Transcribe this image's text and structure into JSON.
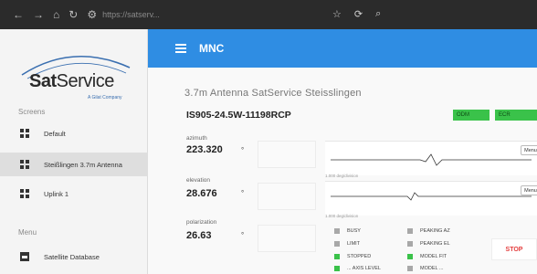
{
  "browser": {
    "url": "https://satserv..."
  },
  "sidebar": {
    "logo": {
      "brand_bold": "Sat",
      "brand_rest": "Service",
      "subline": "A Gilat Company"
    },
    "screens_label": "Screens",
    "screens": [
      {
        "label": "Default",
        "active": false
      },
      {
        "label": "Steißlingen 3.7m Antenna",
        "active": true
      },
      {
        "label": "Uplink 1",
        "active": false
      }
    ],
    "menu_label": "Menu",
    "menu": [
      {
        "label": "Satellite Database"
      }
    ]
  },
  "header": {
    "title": "MNC"
  },
  "main": {
    "page_title": "3.7m Antenna SatService Steisslingen",
    "satellite_id": "IS905-24.5W-11198RCP",
    "badges": [
      "ODM",
      "ECR"
    ],
    "fields": [
      {
        "label": "azimuth",
        "value": "223.320",
        "unit": "°"
      },
      {
        "label": "elevation",
        "value": "28.676",
        "unit": "°"
      },
      {
        "label": "polarization",
        "value": "26.63",
        "unit": "°"
      }
    ],
    "panels": [
      {
        "menu_label": "Menu",
        "caption": "1.000 deg/division"
      },
      {
        "menu_label": "Menu",
        "caption": "1.000 deg/division"
      }
    ],
    "status_left": [
      {
        "label": "BUSY",
        "color": "#a8a8a8"
      },
      {
        "label": "LIMIT",
        "color": "#a8a8a8"
      },
      {
        "label": "STOPPED",
        "color": "#3ac24a"
      },
      {
        "label": "... AXIS LEVEL",
        "color": "#3ac24a"
      }
    ],
    "status_right": [
      {
        "label": "PEAKING AZ",
        "color": "#a8a8a8"
      },
      {
        "label": "PEAKING EL",
        "color": "#a8a8a8"
      },
      {
        "label": "MODEL FIT",
        "color": "#3ac24a"
      },
      {
        "label": "MODEL ...",
        "color": "#a8a8a8"
      }
    ],
    "stop_label": "STOP"
  }
}
